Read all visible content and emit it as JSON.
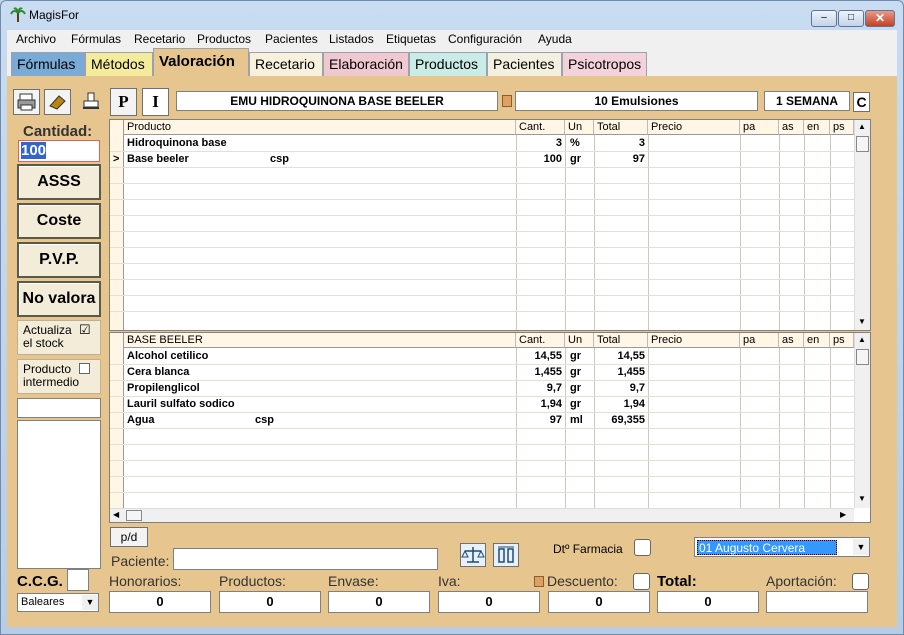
{
  "window": {
    "title": "MagisFor",
    "min": "–",
    "max": "□",
    "close": "✕"
  },
  "menu": [
    "Archivo",
    "Fórmulas",
    "Recetario",
    "Productos",
    "Pacientes",
    "Listados",
    "Etiquetas",
    "Configuración",
    "Ayuda"
  ],
  "tabs": [
    "Fórmulas",
    "Métodos",
    "Valoración",
    "Recetario",
    "Elaboración",
    "Productos",
    "Pacientes",
    "Psicotropos"
  ],
  "tab_colors": [
    "#79abd6",
    "#f4ec9a",
    "#f3e6c6",
    "#f7f0dd",
    "#f0c8d0",
    "#c9ece6",
    "#f3f0e0",
    "#f4d2dc"
  ],
  "active_tab": "Valoración",
  "toolbar": {
    "p_label": "P",
    "i_label": "I",
    "c_label": "C"
  },
  "header": {
    "formula_name": "EMU HIDROQUINONA BASE BEELER",
    "quantity_desc": "10 Emulsiones",
    "duration": "1 SEMANA"
  },
  "left_panel": {
    "cantidad_label": "Cantidad:",
    "cantidad_value": "100",
    "buttons": [
      "ASSS",
      "Coste",
      "P.V.P.",
      "No valora"
    ],
    "actualiza_stock": "Actualiza el stock",
    "actualiza_checked": "☑",
    "producto_intermedio": "Producto intermedio"
  },
  "grid1": {
    "columns": [
      "Producto",
      "Cant.",
      "Un",
      "Total",
      "Precio",
      "pa",
      "as",
      "en",
      "ps"
    ],
    "rows": [
      {
        "marker": "",
        "producto": "Hidroquinona base",
        "extra": "",
        "cant": "3",
        "un": "%",
        "total": "3"
      },
      {
        "marker": ">",
        "producto": "Base beeler",
        "extra": "csp",
        "cant": "100",
        "un": "gr",
        "total": "97"
      }
    ]
  },
  "grid2": {
    "columns": [
      "BASE BEELER",
      "Cant.",
      "Un",
      "Total",
      "Precio",
      "pa",
      "as",
      "en",
      "ps"
    ],
    "rows": [
      {
        "producto": "Alcohol cetilico",
        "extra": "",
        "cant": "14,55",
        "un": "gr",
        "total": "14,55"
      },
      {
        "producto": "Cera blanca",
        "extra": "",
        "cant": "1,455",
        "un": "gr",
        "total": "1,455"
      },
      {
        "producto": "Propilenglicol",
        "extra": "",
        "cant": "9,7",
        "un": "gr",
        "total": "9,7"
      },
      {
        "producto": "Lauril sulfato sodico",
        "extra": "",
        "cant": "1,94",
        "un": "gr",
        "total": "1,94"
      },
      {
        "producto": "Agua",
        "extra": "csp",
        "cant": "97",
        "un": "ml",
        "total": "69,355"
      }
    ]
  },
  "bottom": {
    "pd_label": "p/d",
    "paciente_label": "Paciente:",
    "paciente_value": "",
    "farmacia_label": "Dtº Farmacia",
    "pharmacist": "01 Augusto Cervera",
    "ccg_label": "C.C.G.",
    "region": "Baleares"
  },
  "totals": {
    "honorarios_label": "Honorarios:",
    "honorarios": "0",
    "productos_label": "Productos:",
    "productos": "0",
    "envase_label": "Envase:",
    "envase": "0",
    "iva_label": "Iva:",
    "iva": "0",
    "descuento_label": "Descuento:",
    "descuento": "0",
    "total_label": "Total:",
    "total": "0",
    "aportacion_label": "Aportación:",
    "aportacion": ""
  }
}
